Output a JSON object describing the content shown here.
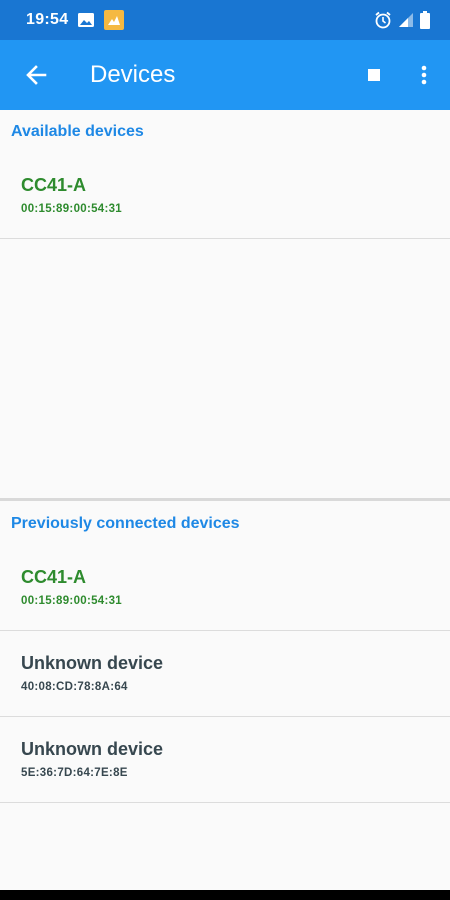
{
  "status_bar": {
    "time": "19:54",
    "left_icons": [
      "image-icon",
      "app-notification-icon"
    ],
    "right_icons": [
      "alarm-icon",
      "signal-icon",
      "battery-icon"
    ],
    "color": "#1976d2"
  },
  "app_bar": {
    "title": "Devices",
    "back_icon": "arrow-back-icon",
    "stop_icon": "stop-icon",
    "more_icon": "more-vert-icon",
    "color": "#2196f3"
  },
  "available": {
    "header": "Available devices",
    "devices": [
      {
        "name": "CC41-A",
        "address": "00:15:89:00:54:31",
        "color": "#2e8b2e"
      }
    ]
  },
  "previous": {
    "header": "Previously connected devices",
    "devices": [
      {
        "name": "CC41-A",
        "address": "00:15:89:00:54:31",
        "color": "#2e8b2e"
      },
      {
        "name": "Unknown device",
        "address": "40:08:CD:78:8A:64",
        "color": "#37474f"
      },
      {
        "name": "Unknown device",
        "address": "5E:36:7D:64:7E:8E",
        "color": "#37474f"
      }
    ]
  },
  "accent_color": "#1e88e5"
}
